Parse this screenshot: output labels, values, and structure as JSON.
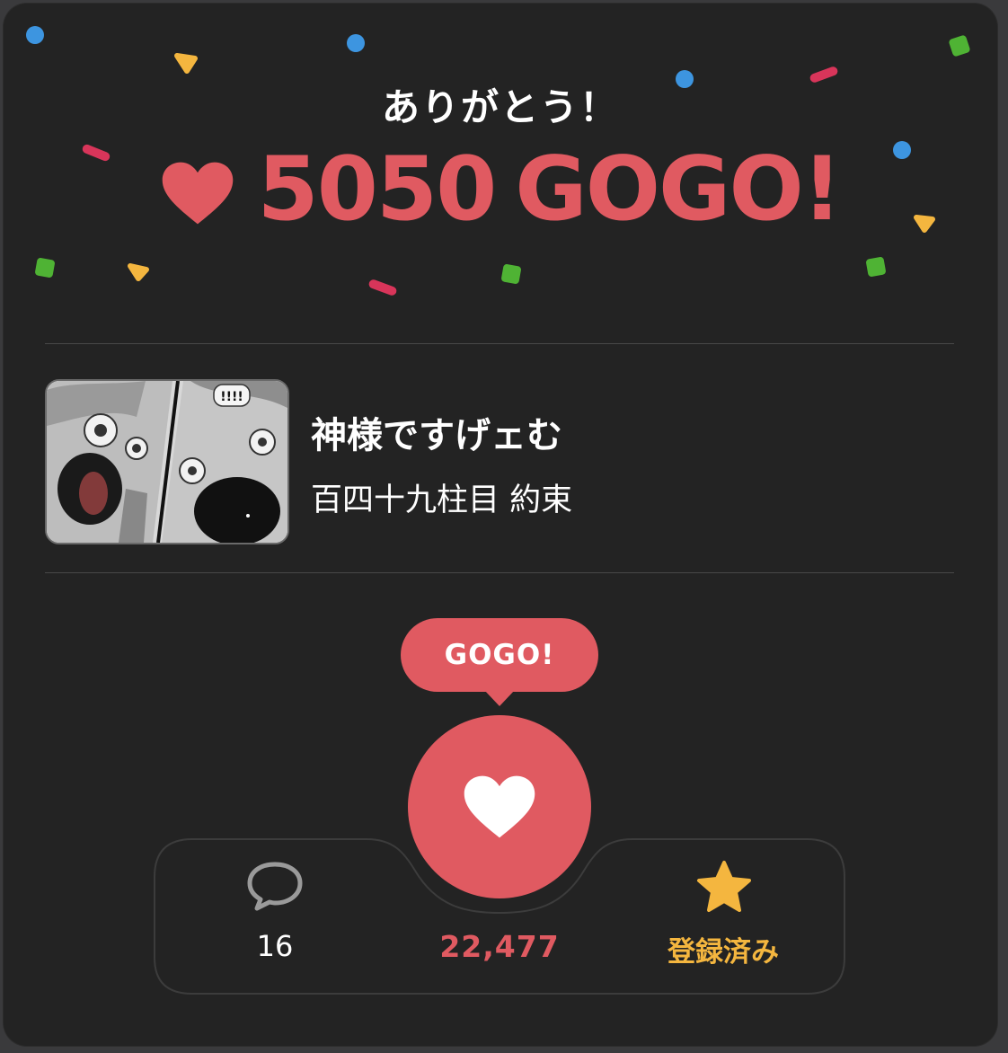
{
  "colors": {
    "accent": "#e05a61",
    "favorite": "#f4b63f",
    "background": "#232323",
    "confetti_blue": "#3d95e0",
    "confetti_yellow": "#f4b63f",
    "confetti_green": "#4fb334",
    "confetti_pink": "#d8355a"
  },
  "header": {
    "thanks": "ありがとう！",
    "gogo_count": "5050",
    "gogo_label": "GOGO!",
    "heart_icon": "heart-icon"
  },
  "work": {
    "thumbnail_icon": "manga-thumbnail",
    "series_title": "神様ですげェむ",
    "episode_title": "百四十九柱目 約束"
  },
  "actions": {
    "bubble_label": "GOGO!",
    "comment_icon": "speech-bubble-icon",
    "comment_count": "16",
    "like_count": "22,477",
    "favorite_icon": "star-icon",
    "favorite_label": "登録済み"
  }
}
